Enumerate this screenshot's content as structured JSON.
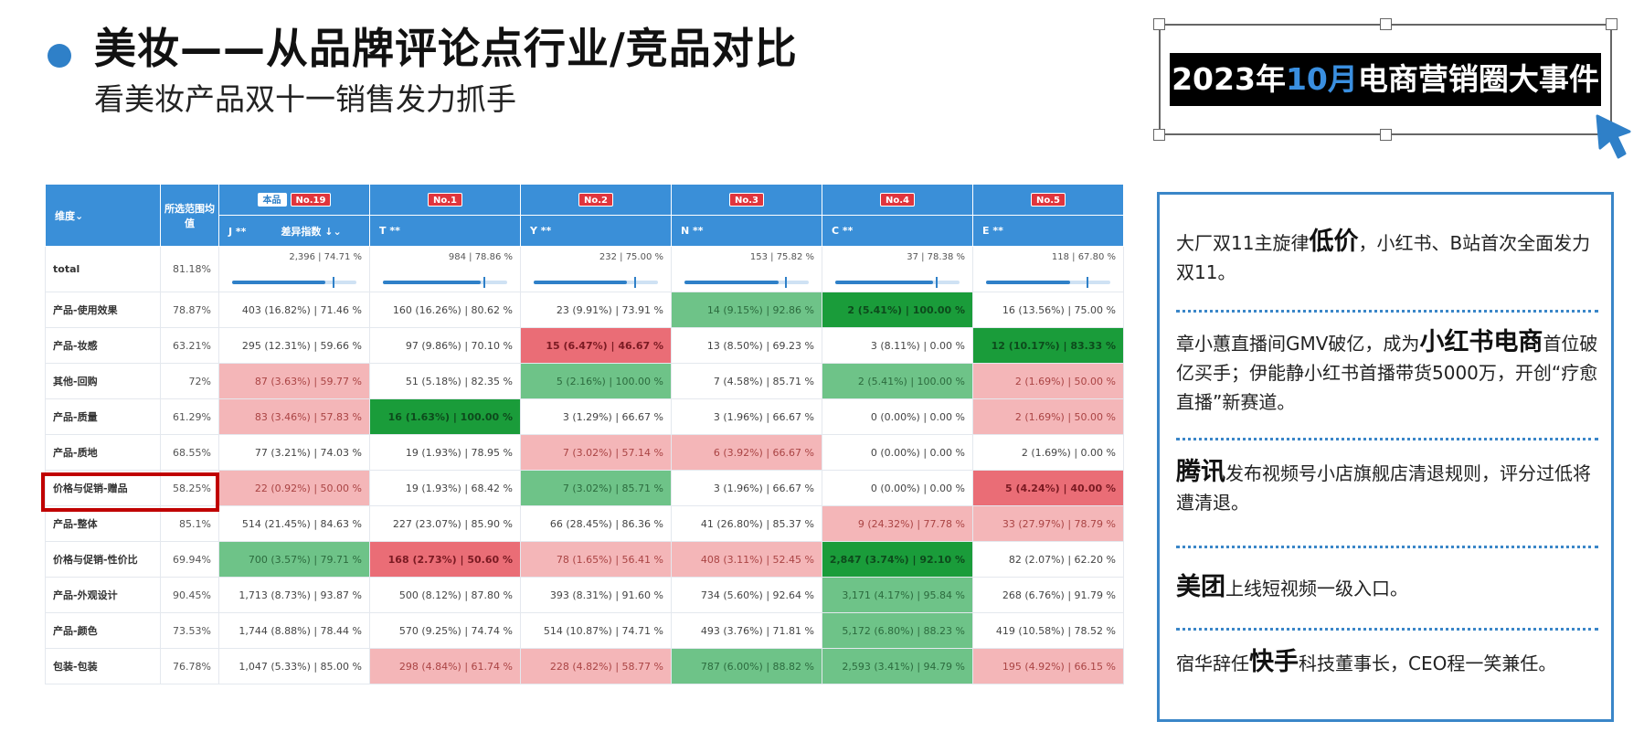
{
  "header": {
    "title": "美妆——从品牌评论点行业/竞品对比",
    "subtitle": "看美妆产品双十一销售发力抓手"
  },
  "event_box": {
    "title_pre": "2023年",
    "title_month": "10月",
    "title_post": "电商营销圈大事件"
  },
  "table": {
    "header": {
      "dim_label": "维度⌄",
      "avg_label": "所选范围均值",
      "brands": [
        {
          "self_tag": "本品",
          "rank": "No.19",
          "name": "J  **",
          "extra": "差异指数 ↓⌄"
        },
        {
          "self_tag": "",
          "rank": "No.1",
          "name": "T  **",
          "extra": ""
        },
        {
          "self_tag": "",
          "rank": "No.2",
          "name": "Y  **",
          "extra": ""
        },
        {
          "self_tag": "",
          "rank": "No.3",
          "name": "N  **",
          "extra": ""
        },
        {
          "self_tag": "",
          "rank": "No.4",
          "name": "C  **",
          "extra": ""
        },
        {
          "self_tag": "",
          "rank": "No.5",
          "name": "E  **",
          "extra": ""
        }
      ]
    },
    "total_row": {
      "label": "total",
      "avg": "81.18%",
      "cells": [
        {
          "text": "2,396 | 74.71 %",
          "ratio": 0.7471
        },
        {
          "text": "984 | 78.86 %",
          "ratio": 0.7886
        },
        {
          "text": "232 | 75.00 %",
          "ratio": 0.75
        },
        {
          "text": "153 | 75.82 %",
          "ratio": 0.7582
        },
        {
          "text": "37 | 78.38 %",
          "ratio": 0.7838
        },
        {
          "text": "118 | 67.80 %",
          "ratio": 0.678
        }
      ]
    },
    "rows": [
      {
        "label": "产品-使用效果",
        "avg": "78.87%",
        "cells": [
          {
            "text": "403 (16.82%) | 71.46 %",
            "c": ""
          },
          {
            "text": "160 (16.26%) | 80.62 %",
            "c": ""
          },
          {
            "text": "23 (9.91%) | 73.91 %",
            "c": ""
          },
          {
            "text": "14 (9.15%) | 92.86 %",
            "c": "lg"
          },
          {
            "text": "2 (5.41%) | 100.00 %",
            "c": "dg"
          },
          {
            "text": "16 (13.56%) | 75.00 %",
            "c": ""
          }
        ]
      },
      {
        "label": "产品-妆感",
        "avg": "63.21%",
        "cells": [
          {
            "text": "295 (12.31%) | 59.66 %",
            "c": ""
          },
          {
            "text": "97 (9.86%) | 70.10 %",
            "c": ""
          },
          {
            "text": "15 (6.47%) | 46.67 %",
            "c": "mr"
          },
          {
            "text": "13 (8.50%) | 69.23 %",
            "c": ""
          },
          {
            "text": "3 (8.11%) | 0.00 %",
            "c": ""
          },
          {
            "text": "12 (10.17%) | 83.33 %",
            "c": "dg"
          }
        ]
      },
      {
        "label": "其他-回购",
        "avg": "72%",
        "cells": [
          {
            "text": "87 (3.63%) | 59.77 %",
            "c": "lr"
          },
          {
            "text": "51 (5.18%) | 82.35 %",
            "c": ""
          },
          {
            "text": "5 (2.16%) | 100.00 %",
            "c": "lg"
          },
          {
            "text": "7 (4.58%) | 85.71 %",
            "c": ""
          },
          {
            "text": "2 (5.41%) | 100.00 %",
            "c": "lg"
          },
          {
            "text": "2 (1.69%) | 50.00 %",
            "c": "lr"
          }
        ]
      },
      {
        "label": "产品-质量",
        "avg": "61.29%",
        "cells": [
          {
            "text": "83 (3.46%) | 57.83 %",
            "c": "lr"
          },
          {
            "text": "16 (1.63%) | 100.00 %",
            "c": "dg"
          },
          {
            "text": "3 (1.29%) | 66.67 %",
            "c": ""
          },
          {
            "text": "3 (1.96%) | 66.67 %",
            "c": ""
          },
          {
            "text": "0 (0.00%) | 0.00 %",
            "c": ""
          },
          {
            "text": "2 (1.69%) | 50.00 %",
            "c": "lr"
          }
        ]
      },
      {
        "label": "产品-质地",
        "avg": "68.55%",
        "cells": [
          {
            "text": "77 (3.21%) | 74.03 %",
            "c": ""
          },
          {
            "text": "19 (1.93%) | 78.95 %",
            "c": ""
          },
          {
            "text": "7 (3.02%) | 57.14 %",
            "c": "lr"
          },
          {
            "text": "6 (3.92%) | 66.67 %",
            "c": "lr"
          },
          {
            "text": "0 (0.00%) | 0.00 %",
            "c": ""
          },
          {
            "text": "2 (1.69%) | 0.00 %",
            "c": ""
          }
        ]
      },
      {
        "label": "价格与促销-赠品",
        "avg": "58.25%",
        "cells": [
          {
            "text": "22 (0.92%) | 50.00 %",
            "c": "lr"
          },
          {
            "text": "19 (1.93%) | 68.42 %",
            "c": ""
          },
          {
            "text": "7 (3.02%) | 85.71 %",
            "c": "lg"
          },
          {
            "text": "3 (1.96%) | 66.67 %",
            "c": ""
          },
          {
            "text": "0 (0.00%) | 0.00 %",
            "c": ""
          },
          {
            "text": "5 (4.24%) | 40.00 %",
            "c": "mr"
          }
        ]
      },
      {
        "label": "产品-整体",
        "avg": "85.1%",
        "cells": [
          {
            "text": "514 (21.45%) | 84.63 %",
            "c": ""
          },
          {
            "text": "227 (23.07%) | 85.90 %",
            "c": ""
          },
          {
            "text": "66 (28.45%) | 86.36 %",
            "c": ""
          },
          {
            "text": "41 (26.80%) | 85.37 %",
            "c": ""
          },
          {
            "text": "9 (24.32%) | 77.78 %",
            "c": "lr"
          },
          {
            "text": "33 (27.97%) | 78.79 %",
            "c": "lr"
          }
        ]
      },
      {
        "label": "价格与促销-性价比",
        "avg": "69.94%",
        "cells": [
          {
            "text": "700 (3.57%) | 79.71 %",
            "c": "lg"
          },
          {
            "text": "168 (2.73%) | 50.60 %",
            "c": "mr"
          },
          {
            "text": "78 (1.65%) | 56.41 %",
            "c": "lr"
          },
          {
            "text": "408 (3.11%) | 52.45 %",
            "c": "lr"
          },
          {
            "text": "2,847 (3.74%) | 92.10 %",
            "c": "dg"
          },
          {
            "text": "82 (2.07%) | 62.20 %",
            "c": ""
          }
        ]
      },
      {
        "label": "产品-外观设计",
        "avg": "90.45%",
        "cells": [
          {
            "text": "1,713 (8.73%) | 93.87 %",
            "c": ""
          },
          {
            "text": "500 (8.12%) | 87.80 %",
            "c": ""
          },
          {
            "text": "393 (8.31%) | 91.60 %",
            "c": ""
          },
          {
            "text": "734 (5.60%) | 92.64 %",
            "c": ""
          },
          {
            "text": "3,171 (4.17%) | 95.84 %",
            "c": "lg"
          },
          {
            "text": "268 (6.76%) | 91.79 %",
            "c": ""
          }
        ]
      },
      {
        "label": "产品-颜色",
        "avg": "73.53%",
        "cells": [
          {
            "text": "1,744 (8.88%) | 78.44 %",
            "c": ""
          },
          {
            "text": "570 (9.25%) | 74.74 %",
            "c": ""
          },
          {
            "text": "514 (10.87%) | 74.71 %",
            "c": ""
          },
          {
            "text": "493 (3.76%) | 71.81 %",
            "c": ""
          },
          {
            "text": "5,172 (6.80%) | 88.23 %",
            "c": "lg"
          },
          {
            "text": "419 (10.58%) | 78.52 %",
            "c": ""
          }
        ]
      },
      {
        "label": "包装-包装",
        "avg": "76.78%",
        "cells": [
          {
            "text": "1,047 (5.33%) | 85.00 %",
            "c": ""
          },
          {
            "text": "298 (4.84%) | 61.74 %",
            "c": "lr"
          },
          {
            "text": "228 (4.82%) | 58.77 %",
            "c": "lr"
          },
          {
            "text": "787 (6.00%) | 88.82 %",
            "c": "lg"
          },
          {
            "text": "2,593 (3.41%) | 94.79 %",
            "c": "lg"
          },
          {
            "text": "195 (4.92%) | 66.15 %",
            "c": "lr"
          }
        ]
      }
    ]
  },
  "news": [
    {
      "pre": "大厂双11主旋律",
      "kw": "低价",
      "post": "，小红书、B站首次全面发力双11。"
    },
    {
      "pre": "章小蕙直播间GMV破亿，成为",
      "kw": "小红书电商",
      "post": "首位破亿买手；伊能静小红书首播带货5000万，开创“疗愈直播”新赛道。"
    },
    {
      "pre": "",
      "kw": "腾讯",
      "post": "发布视频号小店旗舰店清退规则，评分过低将遭清退。"
    },
    {
      "pre": "",
      "kw": "美团",
      "post": "上线短视频一级入口。"
    },
    {
      "pre": "宿华辞任",
      "kw": "快手",
      "post": "科技董事长，CEO程一笑兼任。"
    }
  ],
  "colors": {
    "accent": "#2f80c8",
    "header_bg": "#3a8fd8",
    "light_red": "#f4b6b8",
    "mid_red": "#ea6d76",
    "light_green": "#6ec388",
    "dark_green": "#1a9c3a",
    "highlight": "#c00000"
  }
}
